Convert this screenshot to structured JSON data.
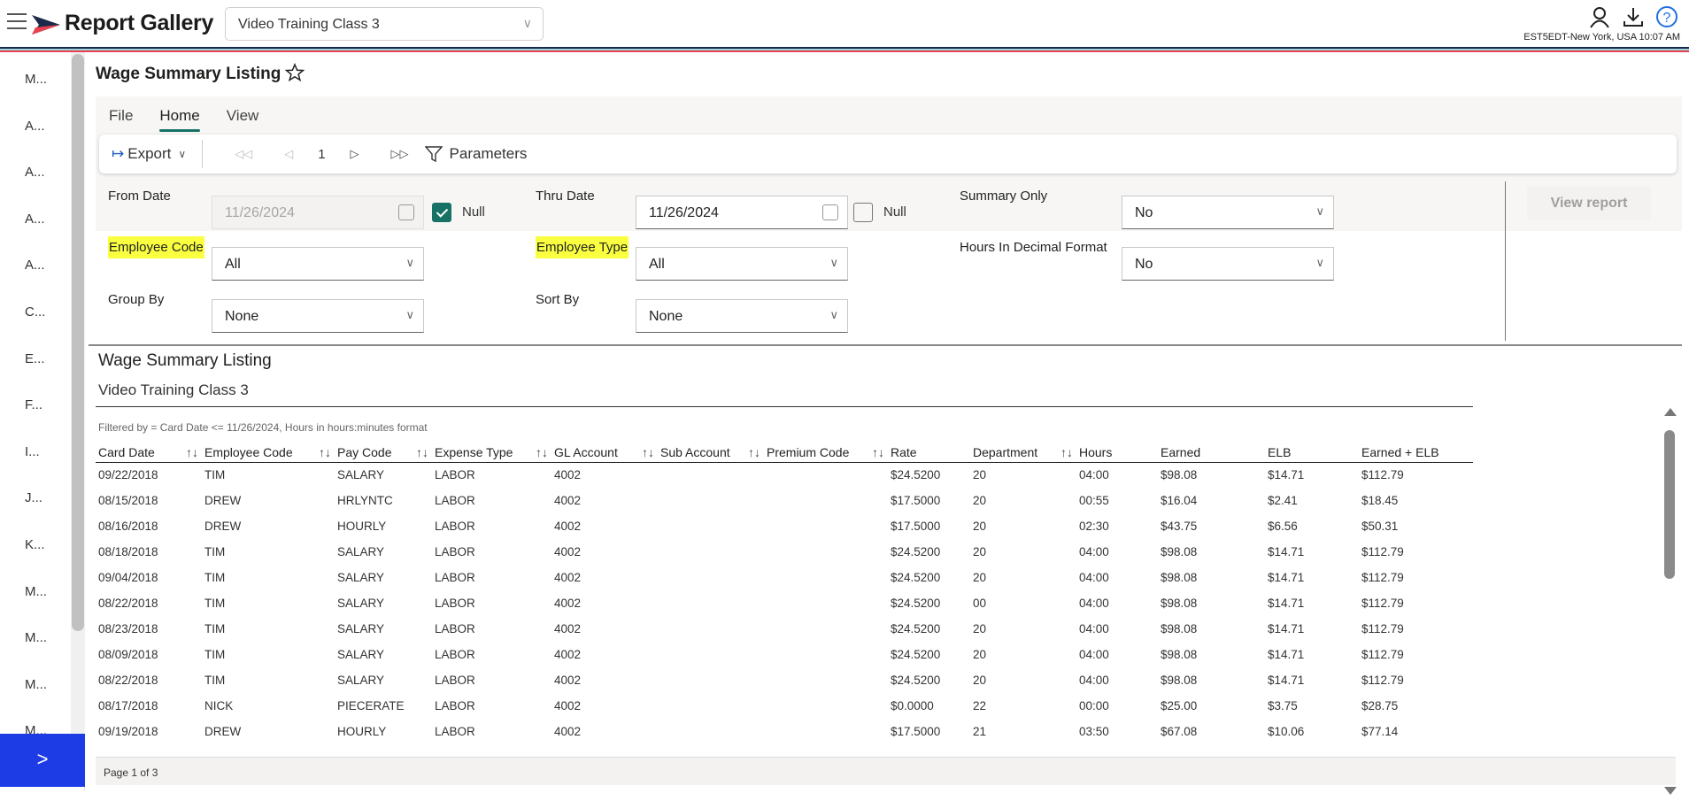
{
  "header": {
    "app_title": "Report Gallery",
    "company_selected": "Video Training Class 3",
    "timezone_time": "EST5EDT-New York, USA 10:07 AM",
    "icons": [
      "menu-icon",
      "user-icon",
      "download-icon",
      "help-icon"
    ],
    "stripe_colors": [
      "#1b2a4a",
      "#9fd3dc",
      "#e8414f"
    ],
    "accent_color": "#1e3ce6"
  },
  "sidebar": {
    "items": [
      "M...",
      "A...",
      "A...",
      "A...",
      "A...",
      "C...",
      "E...",
      "F...",
      "I...",
      "J...",
      "K...",
      "M...",
      "M...",
      "M...",
      "M..."
    ],
    "expand_label": ">"
  },
  "page": {
    "title": "Wage Summary Listing"
  },
  "ribbon": {
    "tabs": [
      {
        "label": "File",
        "active": false
      },
      {
        "label": "Home",
        "active": true
      },
      {
        "label": "View",
        "active": false
      }
    ],
    "export_label": "Export",
    "page_number": "1",
    "parameters_label": "Parameters"
  },
  "params": {
    "from_date": {
      "label": "From Date",
      "value": "11/26/2024",
      "null_label": "Null",
      "null_checked": true
    },
    "thru_date": {
      "label": "Thru Date",
      "value": "11/26/2024",
      "null_label": "Null",
      "null_checked": false
    },
    "summary_only": {
      "label": "Summary Only",
      "value": "No"
    },
    "employee_code": {
      "label": "Employee Code",
      "value": "All"
    },
    "employee_type": {
      "label": "Employee Type",
      "value": "All"
    },
    "hours_decimal": {
      "label": "Hours In Decimal Format",
      "value": "No"
    },
    "group_by": {
      "label": "Group By",
      "value": "None"
    },
    "sort_by": {
      "label": "Sort By",
      "value": "None"
    },
    "view_report_label": "View report",
    "highlight_color": "#faff40",
    "check_color": "#177265"
  },
  "report": {
    "title": "Wage Summary Listing",
    "subtitle": "Video Training Class 3",
    "filter_text": "Filtered by = Card Date <= 11/26/2024, Hours in hours:minutes format",
    "columns": [
      "Card Date",
      "Employee Code",
      "Pay Code",
      "Expense Type",
      "GL Account",
      "Sub Account",
      "Premium Code",
      "Rate",
      "Department",
      "Hours",
      "Earned",
      "ELB",
      "Earned + ELB"
    ],
    "rows": [
      [
        "09/22/2018",
        "TIM",
        "SALARY",
        "LABOR",
        "4002",
        "",
        "",
        "$24.5200",
        "20",
        "04:00",
        "$98.08",
        "$14.71",
        "$112.79"
      ],
      [
        "08/15/2018",
        "DREW",
        "HRLYNTC",
        "LABOR",
        "4002",
        "",
        "",
        "$17.5000",
        "20",
        "00:55",
        "$16.04",
        "$2.41",
        "$18.45"
      ],
      [
        "08/16/2018",
        "DREW",
        "HOURLY",
        "LABOR",
        "4002",
        "",
        "",
        "$17.5000",
        "20",
        "02:30",
        "$43.75",
        "$6.56",
        "$50.31"
      ],
      [
        "08/18/2018",
        "TIM",
        "SALARY",
        "LABOR",
        "4002",
        "",
        "",
        "$24.5200",
        "20",
        "04:00",
        "$98.08",
        "$14.71",
        "$112.79"
      ],
      [
        "09/04/2018",
        "TIM",
        "SALARY",
        "LABOR",
        "4002",
        "",
        "",
        "$24.5200",
        "20",
        "04:00",
        "$98.08",
        "$14.71",
        "$112.79"
      ],
      [
        "08/22/2018",
        "TIM",
        "SALARY",
        "LABOR",
        "4002",
        "",
        "",
        "$24.5200",
        "00",
        "04:00",
        "$98.08",
        "$14.71",
        "$112.79"
      ],
      [
        "08/23/2018",
        "TIM",
        "SALARY",
        "LABOR",
        "4002",
        "",
        "",
        "$24.5200",
        "20",
        "04:00",
        "$98.08",
        "$14.71",
        "$112.79"
      ],
      [
        "08/09/2018",
        "TIM",
        "SALARY",
        "LABOR",
        "4002",
        "",
        "",
        "$24.5200",
        "20",
        "04:00",
        "$98.08",
        "$14.71",
        "$112.79"
      ],
      [
        "08/22/2018",
        "TIM",
        "SALARY",
        "LABOR",
        "4002",
        "",
        "",
        "$24.5200",
        "20",
        "04:00",
        "$98.08",
        "$14.71",
        "$112.79"
      ],
      [
        "08/17/2018",
        "NICK",
        "PIECERATE",
        "LABOR",
        "4002",
        "",
        "",
        "$0.0000",
        "22",
        "00:00",
        "$25.00",
        "$3.75",
        "$28.75"
      ],
      [
        "09/19/2018",
        "DREW",
        "HOURLY",
        "LABOR",
        "4002",
        "",
        "",
        "$17.5000",
        "21",
        "03:50",
        "$67.08",
        "$10.06",
        "$77.14"
      ]
    ],
    "page_status": "Page 1 of 3"
  }
}
